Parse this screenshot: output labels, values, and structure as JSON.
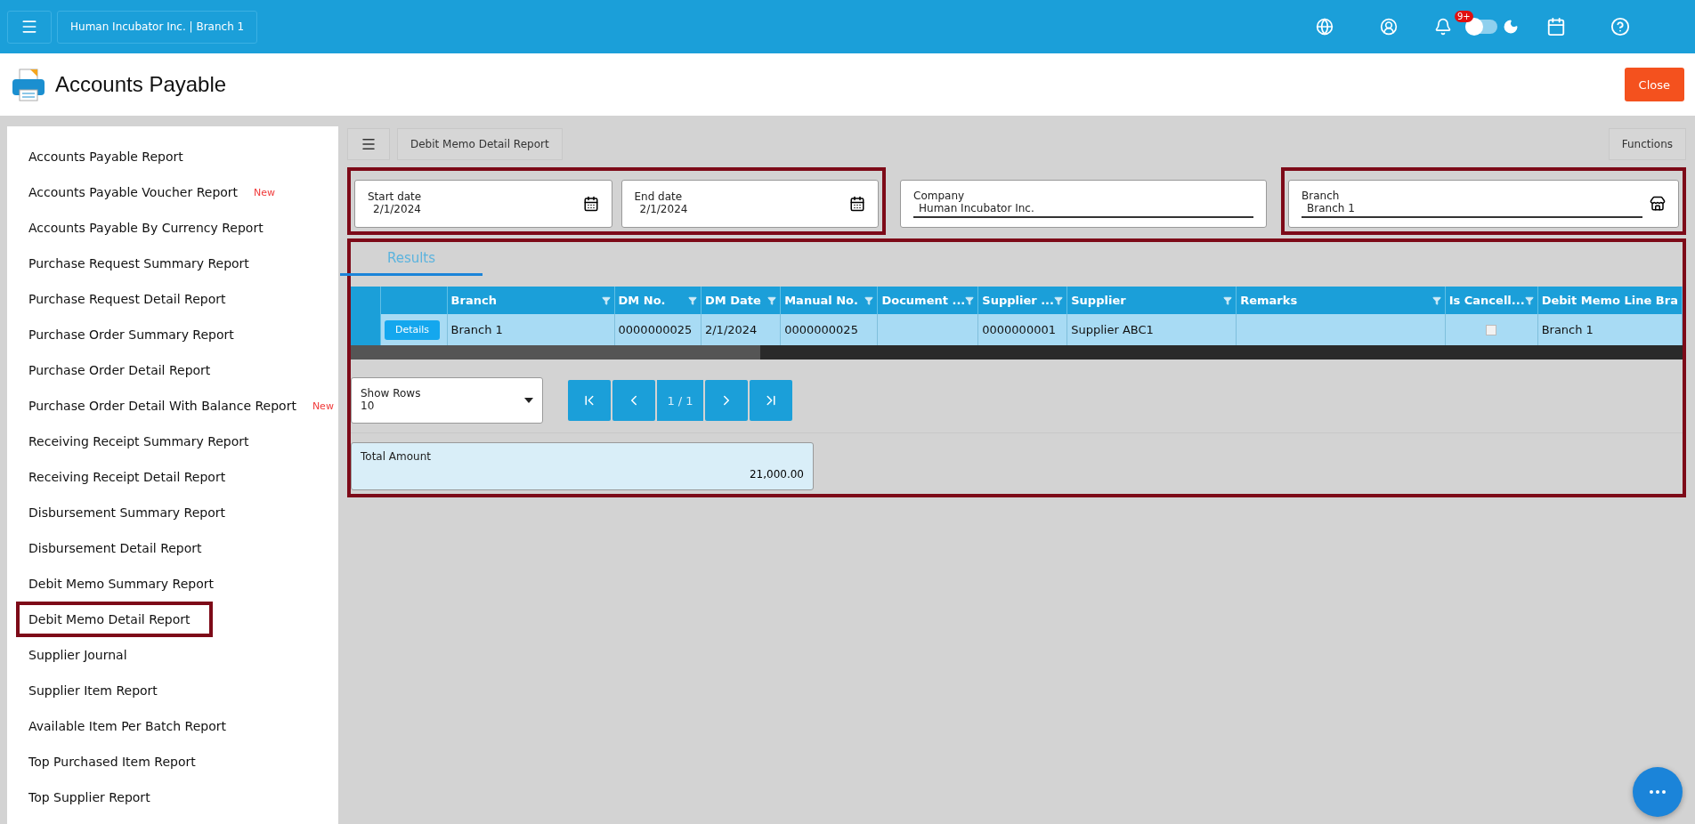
{
  "top_bar": {
    "company_branch": "Human Incubator Inc. | Branch 1",
    "notification_count": "9+",
    "dark_mode": {
      "on": false
    }
  },
  "header": {
    "title": "Accounts Payable",
    "close_button": "Close"
  },
  "sidebar": {
    "items": [
      {
        "label": "Accounts Payable Report",
        "highlighted": false
      },
      {
        "label": "Accounts Payable Voucher Report",
        "badge": "New",
        "highlighted": false
      },
      {
        "label": "Accounts Payable By Currency Report",
        "highlighted": false
      },
      {
        "label": "Purchase Request Summary Report",
        "highlighted": false
      },
      {
        "label": "Purchase Request Detail Report",
        "highlighted": false
      },
      {
        "label": "Purchase Order Summary Report",
        "highlighted": false
      },
      {
        "label": "Purchase Order Detail Report",
        "highlighted": false
      },
      {
        "label": "Purchase Order Detail With Balance Report",
        "badge": "New",
        "highlighted": false
      },
      {
        "label": "Receiving Receipt Summary Report",
        "highlighted": false
      },
      {
        "label": "Receiving Receipt Detail Report",
        "highlighted": false
      },
      {
        "label": "Disbursement Summary Report",
        "highlighted": false
      },
      {
        "label": "Disbursement Detail Report",
        "highlighted": false
      },
      {
        "label": "Debit Memo Summary Report",
        "highlighted": false
      },
      {
        "label": "Debit Memo Detail Report",
        "highlighted": true
      },
      {
        "label": "Supplier Journal",
        "highlighted": false
      },
      {
        "label": "Supplier Item Report",
        "highlighted": false
      },
      {
        "label": "Available Item Per Batch Report",
        "highlighted": false
      },
      {
        "label": "Top Purchased Item Report",
        "highlighted": false
      },
      {
        "label": "Top Supplier Report",
        "highlighted": false
      }
    ]
  },
  "report_bar": {
    "title": "Debit Memo Detail Report",
    "functions_button": "Functions"
  },
  "filter_groups": [
    {
      "highlighted": true,
      "fields": [
        {
          "kind": "date",
          "label": "Start date",
          "value": "2/1/2024"
        },
        {
          "kind": "date",
          "label": "End date",
          "value": "2/1/2024"
        }
      ]
    },
    {
      "highlighted": false,
      "fields": [
        {
          "kind": "text",
          "label": "Company",
          "value": "Human Incubator Inc."
        }
      ]
    },
    {
      "highlighted": true,
      "fields": [
        {
          "kind": "store",
          "label": "Branch",
          "value": "Branch 1"
        }
      ]
    }
  ],
  "results": {
    "highlighted": true,
    "tabs": [
      {
        "label": "Results",
        "selected": true
      }
    ],
    "table": {
      "columns": [
        "Branch",
        "DM No.",
        "DM Date",
        "Manual No.",
        "Document ...",
        "Supplier ...",
        "Supplier",
        "Remarks",
        "Is Cancell...",
        "Debit Memo Line Bra"
      ],
      "rows": [
        {
          "selected": true,
          "details_button": "Details",
          "cells": [
            "Branch 1",
            "0000000025",
            "2/1/2024",
            "0000000025",
            null,
            "0000000001",
            "Supplier ABC1",
            null
          ],
          "is_cancelled": false,
          "last_cell": "Branch 1"
        }
      ]
    },
    "show_rows": {
      "label": "Show Rows",
      "value": "10"
    },
    "page": "1 / 1",
    "total": {
      "label": "Total Amount",
      "value": "21,000.00"
    }
  }
}
